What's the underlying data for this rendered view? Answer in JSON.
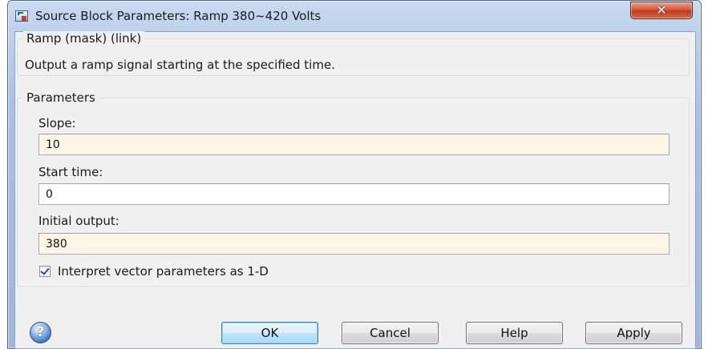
{
  "window": {
    "title": "Source Block Parameters: Ramp 380~420 Volts",
    "close_label": "✕"
  },
  "description": {
    "legend": "Ramp (mask) (link)",
    "text": "Output a ramp signal starting at the specified time."
  },
  "parameters": {
    "legend": "Parameters",
    "slope": {
      "label": "Slope:",
      "value": "10"
    },
    "start_time": {
      "label": "Start time:",
      "value": "0"
    },
    "initial_output": {
      "label": "Initial output:",
      "value": "380"
    },
    "interpret_vector": {
      "label": "Interpret vector parameters as 1-D",
      "checked": true
    }
  },
  "buttons": {
    "help_icon": "?",
    "ok": "OK",
    "cancel": "Cancel",
    "help": "Help",
    "apply": "Apply"
  },
  "colors": {
    "tinted_field": "#fdf5e6",
    "close_button": "#c23a1e",
    "window_frame": "#b8cde9"
  },
  "icons": {
    "app": "simulink-block-icon",
    "close": "close-icon",
    "help": "help-icon",
    "check": "checkmark-icon"
  }
}
